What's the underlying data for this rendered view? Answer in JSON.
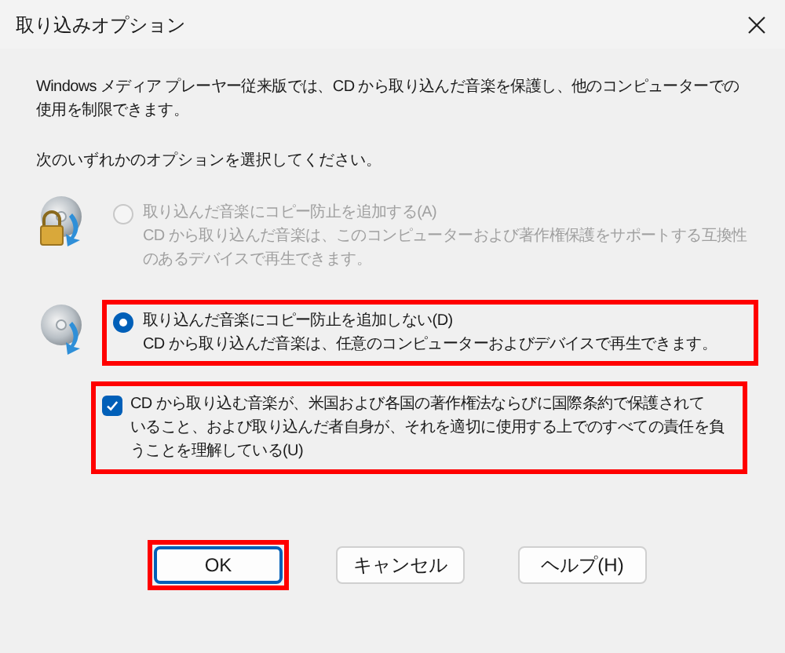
{
  "window": {
    "title": "取り込みオプション"
  },
  "description": [
    "Windows メディア プレーヤー従来版では、CD から取り込んだ音楽を保護し、他のコンピューターでの",
    "使用を制限できます。"
  ],
  "prompt": "次のいずれかのオプションを選択してください。",
  "options": [
    {
      "label": "取り込んだ音楽にコピー防止を追加する(A)",
      "detail": [
        "CD から取り込んだ音楽は、このコンピューターおよび著作権保護をサポートする互換性",
        "のあるデバイスで再生できます。"
      ],
      "selected": false,
      "disabled": true,
      "locked": true,
      "highlighted": false
    },
    {
      "label": "取り込んだ音楽にコピー防止を追加しない(D)",
      "detail": [
        "CD から取り込んだ音楽は、任意のコンピューターおよびデバイスで再生できます。"
      ],
      "selected": true,
      "disabled": false,
      "locked": false,
      "highlighted": true
    }
  ],
  "agreement": {
    "lines": [
      "CD から取り込む音楽が、米国および各国の著作権法ならびに国際条約で保護されて",
      "いること、および取り込んだ者自身が、それを適切に使用する上でのすべての責任を負",
      "うことを理解している(U)"
    ],
    "checked": true,
    "highlighted": true
  },
  "buttons": [
    {
      "label": "OK",
      "default": true,
      "highlighted": true
    },
    {
      "label": "キャンセル",
      "default": false,
      "highlighted": false
    },
    {
      "label": "ヘルプ(H)",
      "default": false,
      "highlighted": false
    }
  ]
}
